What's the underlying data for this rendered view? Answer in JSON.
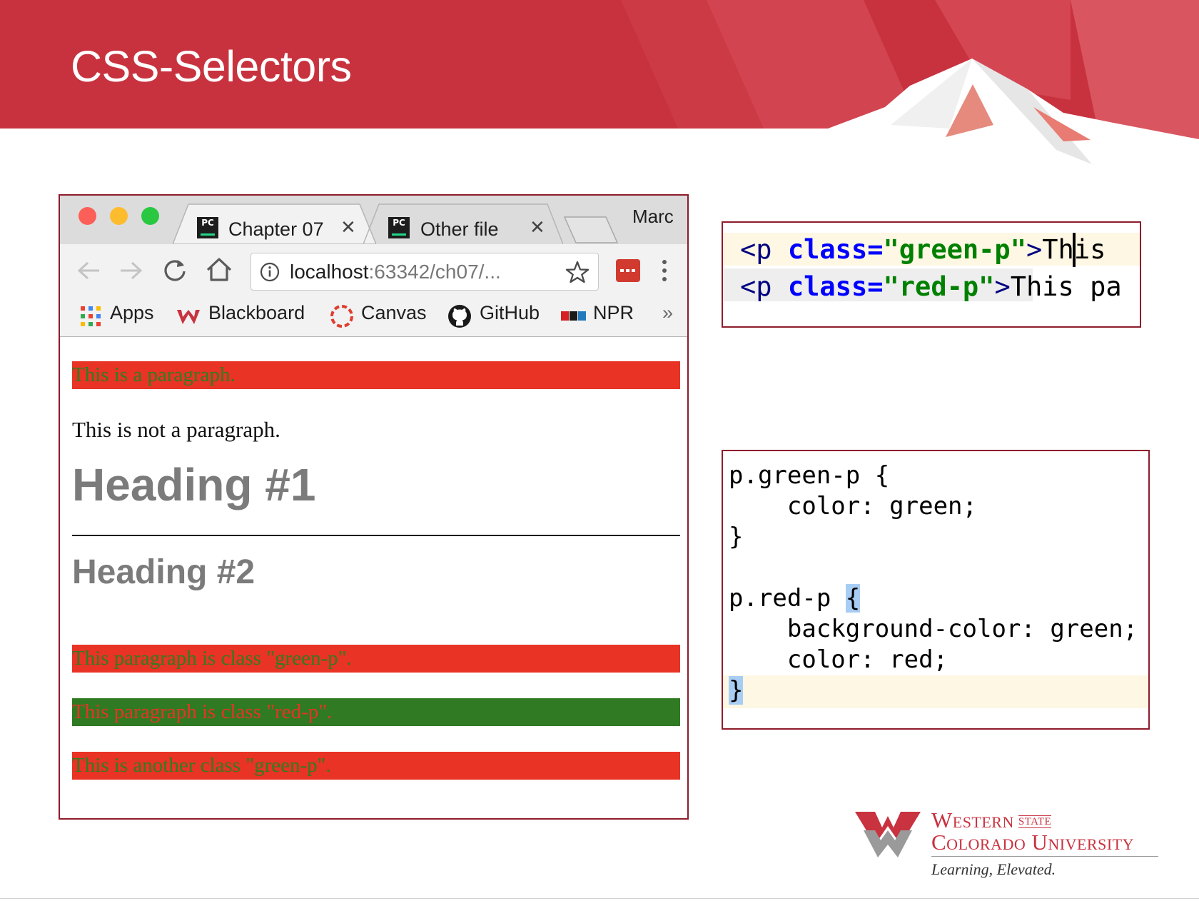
{
  "slide": {
    "title": "CSS-Selectors"
  },
  "browser": {
    "tabs": [
      {
        "label": "Chapter 07",
        "icon": "pycharm-icon",
        "active": true
      },
      {
        "label": "Other file",
        "icon": "pycharm-icon",
        "active": false
      }
    ],
    "profile_name": "Marc",
    "address": {
      "host": "localhost",
      "path": ":63342/ch07/..."
    },
    "bookmarks": [
      {
        "label": "Apps",
        "icon": "apps-grid-icon"
      },
      {
        "label": "Blackboard",
        "icon": "blackboard-icon"
      },
      {
        "label": "Canvas",
        "icon": "canvas-icon"
      },
      {
        "label": "GitHub",
        "icon": "github-icon"
      },
      {
        "label": "NPR",
        "icon": "npr-icon"
      }
    ],
    "overflow_label": "»",
    "page": {
      "para_1": "This is a paragraph.",
      "plain_text": "This is not a paragraph.",
      "heading_1": "Heading #1",
      "heading_2": "Heading #2",
      "para_green_class": "This paragraph is class \"green-p\".",
      "para_red_class": "This paragraph is class \"red-p\".",
      "para_another_green": "This is another class \"green-p\"."
    }
  },
  "html_code": {
    "line_1": {
      "tag": "<p",
      "attr": " class=",
      "value": "\"green-p\"",
      "gt": ">",
      "text_before_caret": "T",
      "text_after_caret": "his"
    },
    "line_2": {
      "tag": "<p",
      "attr": " class=",
      "value": "\"red-p\"",
      "gt": ">",
      "text": "This pa"
    }
  },
  "css_code": {
    "lines": [
      "p.green-p {",
      "    color: green;",
      "}",
      "",
      "p.red-p ",
      "    background-color: green;",
      "    color: red;",
      "}"
    ],
    "red_rule_open_brace": "{"
  },
  "logo": {
    "line_1": "Western",
    "state": "STATE",
    "line_2": "Colorado University",
    "tagline": "Learning, Elevated."
  },
  "colors": {
    "banner_red": "#c8323e",
    "para_red": "#e83325",
    "para_green": "#2f7a22",
    "frame_border": "#8e1b2b"
  }
}
